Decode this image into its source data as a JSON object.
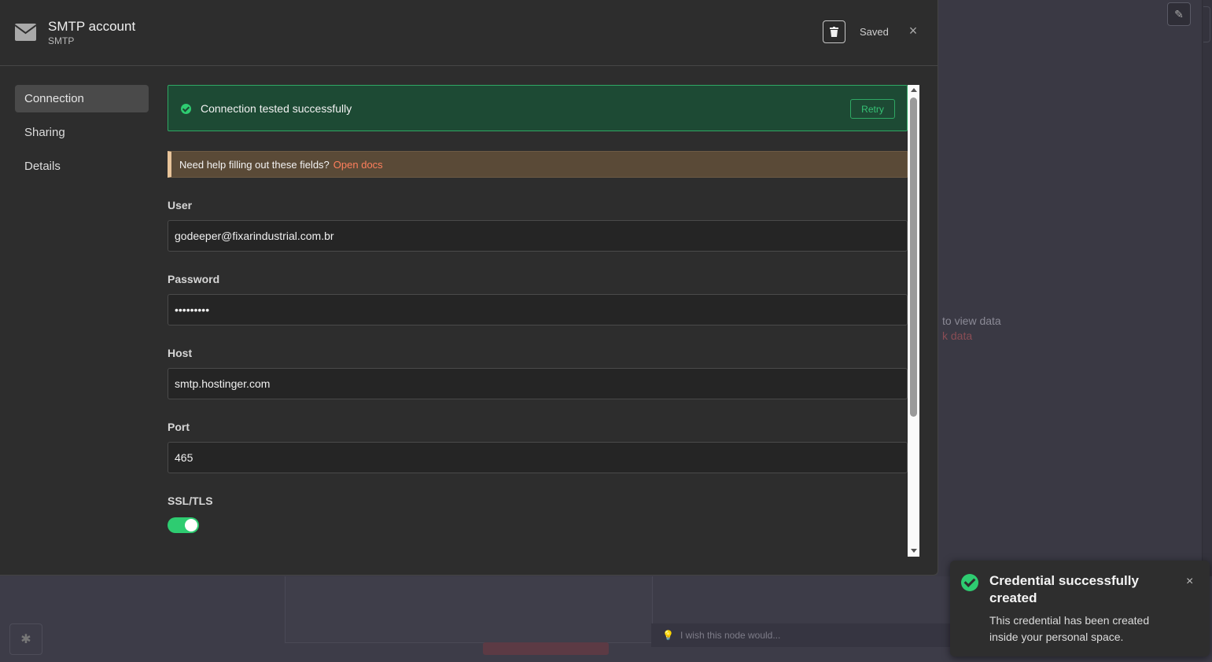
{
  "modal": {
    "title": "SMTP account",
    "subtitle": "SMTP",
    "saved_label": "Saved",
    "close_glyph": "×"
  },
  "sidebar": {
    "items": [
      {
        "label": "Connection",
        "active": true
      },
      {
        "label": "Sharing",
        "active": false
      },
      {
        "label": "Details",
        "active": false
      }
    ]
  },
  "banner": {
    "success_text": "Connection tested successfully",
    "retry_label": "Retry",
    "help_text": "Need help filling out these fields?",
    "help_link": "Open docs"
  },
  "fields": {
    "user": {
      "label": "User",
      "value": "godeeper@fixarindustrial.com.br"
    },
    "password": {
      "label": "Password",
      "value": "•••••••••"
    },
    "host": {
      "label": "Host",
      "value": "smtp.hostinger.com"
    },
    "port": {
      "label": "Port",
      "value": "465"
    },
    "ssl": {
      "label": "SSL/TLS",
      "enabled": true
    }
  },
  "toast": {
    "title": "Credential successfully created",
    "message": "This credential has been created inside your personal space.",
    "close_glyph": "×"
  },
  "background": {
    "hint_line1": "to view data",
    "hint_line2": "k data",
    "input_placeholder": "I wish this node would..."
  },
  "colors": {
    "success": "#2ecc71",
    "success_bg": "#1d4a34",
    "help_accent": "#e8c49a",
    "link": "#ff7f5c"
  },
  "icons": {
    "header": "mail-icon",
    "delete": "trash-icon",
    "close": "close-icon",
    "success": "check-circle-icon",
    "bug": "bug-icon",
    "edit": "pencil-icon",
    "bulb": "lightbulb-icon"
  }
}
